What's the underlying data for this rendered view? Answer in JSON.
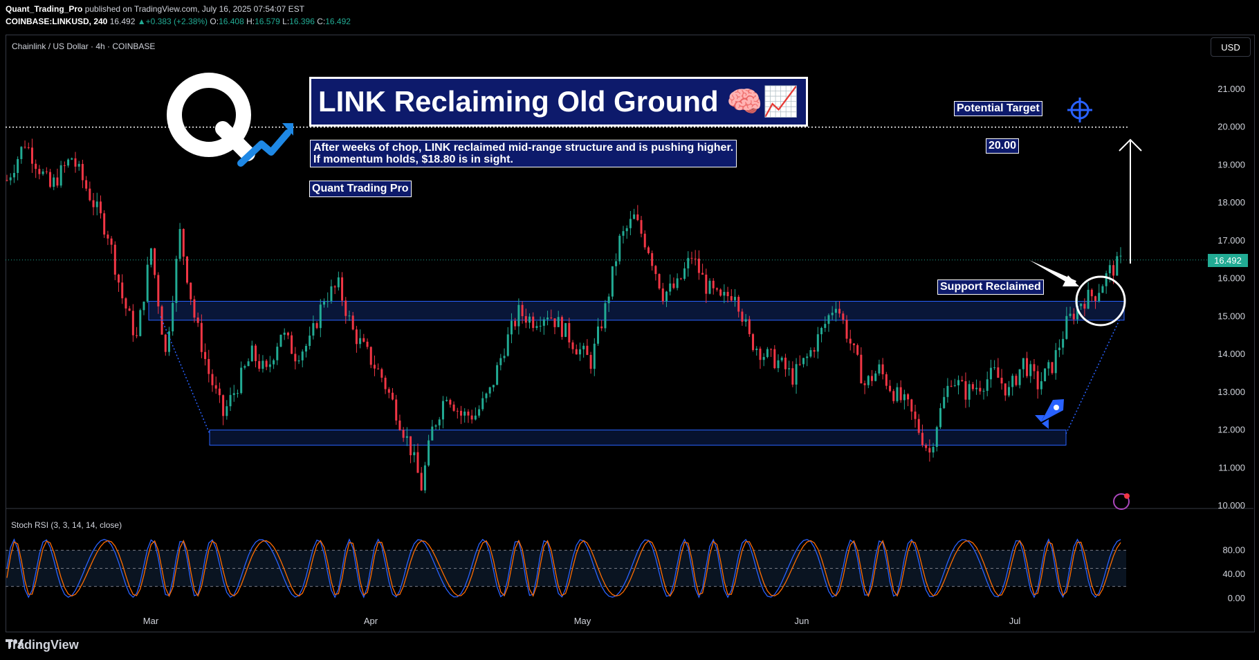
{
  "header": {
    "publisher": "Quant_Trading_Pro",
    "published_text": "published on TradingView.com, July 16, 2025 07:54:07 EST",
    "symbol": "COINBASE:LINKUSD, 240",
    "last": "16.492",
    "change_arrow": "▲",
    "change": "+0.383 (+2.38%)",
    "o_label": "O:",
    "o": "16.408",
    "h_label": "H:",
    "h": "16.579",
    "l_label": "L:",
    "l": "16.396",
    "c_label": "C:",
    "c": "16.492"
  },
  "pane_title": "Chainlink / US Dollar · 4h · COINBASE",
  "currency": "USD",
  "current_price_label": "16.492",
  "annotations": {
    "main_title": "LINK Reclaiming Old Ground 🧠📈",
    "subtitle_line1": "After weeks of chop, LINK reclaimed mid-range structure and is pushing higher.",
    "subtitle_line2": "If momentum holds, $18.80 is in sight.",
    "author": "Quant Trading Pro",
    "potential_target": "Potential Target",
    "target_value": "20.00",
    "support_reclaimed": "Support Reclaimed"
  },
  "indicator_label": "Stoch RSI (3, 3, 14, 14, close)",
  "footer_brand": "TradingView",
  "colors": {
    "up": "#22ab94",
    "down": "#f23645",
    "zone": "#2962ff",
    "stoch_k": "#2962ff",
    "stoch_d": "#ff6d00",
    "box_bg": "#0d1a6b"
  },
  "chart_data": {
    "type": "candlestick",
    "price_axis_ticks": [
      "21.000",
      "20.000",
      "19.000",
      "18.000",
      "17.000",
      "16.000",
      "15.000",
      "14.000",
      "13.000",
      "12.000",
      "11.000",
      "10.000"
    ],
    "ylim": [
      10.0,
      21.5
    ],
    "time_axis_ticks": [
      "Mar",
      "Apr",
      "May",
      "Jun",
      "Jul"
    ],
    "stoch_axis_ticks": [
      "80.00",
      "40.00",
      "0.00"
    ],
    "stoch_levels": [
      80,
      20
    ],
    "target_level": 20.0,
    "zones": [
      {
        "name": "resistance-turned-support",
        "y_low": 14.9,
        "y_high": 15.4
      },
      {
        "name": "range-low",
        "y_low": 11.6,
        "y_high": 12.0
      }
    ],
    "path": [
      [
        0,
        18.6
      ],
      [
        5,
        19.6
      ],
      [
        12,
        18.4
      ],
      [
        18,
        19.2
      ],
      [
        24,
        18.0
      ],
      [
        28,
        17.2
      ],
      [
        32,
        15.5
      ],
      [
        36,
        14.4
      ],
      [
        40,
        16.8
      ],
      [
        44,
        14.0
      ],
      [
        48,
        17.2
      ],
      [
        52,
        15.0
      ],
      [
        56,
        13.5
      ],
      [
        60,
        12.4
      ],
      [
        64,
        13.2
      ],
      [
        68,
        14.0
      ],
      [
        72,
        13.5
      ],
      [
        76,
        14.6
      ],
      [
        80,
        14.0
      ],
      [
        84,
        14.3
      ],
      [
        88,
        15.5
      ],
      [
        92,
        15.8
      ],
      [
        96,
        14.6
      ],
      [
        100,
        14.0
      ],
      [
        104,
        13.4
      ],
      [
        108,
        12.5
      ],
      [
        112,
        11.5
      ],
      [
        115,
        10.5
      ],
      [
        118,
        12.0
      ],
      [
        122,
        13.0
      ],
      [
        126,
        12.4
      ],
      [
        130,
        12.4
      ],
      [
        134,
        13.0
      ],
      [
        138,
        14.2
      ],
      [
        142,
        15.1
      ],
      [
        146,
        14.9
      ],
      [
        150,
        15.1
      ],
      [
        154,
        14.7
      ],
      [
        158,
        14.2
      ],
      [
        162,
        13.8
      ],
      [
        166,
        15.2
      ],
      [
        170,
        17.0
      ],
      [
        174,
        17.6
      ],
      [
        178,
        16.8
      ],
      [
        182,
        15.6
      ],
      [
        186,
        15.8
      ],
      [
        190,
        16.6
      ],
      [
        194,
        15.8
      ],
      [
        198,
        15.4
      ],
      [
        202,
        15.7
      ],
      [
        206,
        14.4
      ],
      [
        210,
        14.0
      ],
      [
        214,
        13.8
      ],
      [
        218,
        13.4
      ],
      [
        222,
        13.9
      ],
      [
        226,
        14.6
      ],
      [
        230,
        15.4
      ],
      [
        234,
        14.3
      ],
      [
        238,
        13.2
      ],
      [
        242,
        13.6
      ],
      [
        246,
        13.0
      ],
      [
        250,
        12.6
      ],
      [
        254,
        11.8
      ],
      [
        256,
        11.4
      ],
      [
        258,
        12.2
      ],
      [
        262,
        13.4
      ],
      [
        266,
        13.0
      ],
      [
        270,
        13.2
      ],
      [
        274,
        13.5
      ],
      [
        278,
        13.0
      ],
      [
        282,
        13.8
      ],
      [
        286,
        13.2
      ],
      [
        290,
        13.7
      ],
      [
        294,
        14.8
      ],
      [
        298,
        15.4
      ],
      [
        302,
        15.6
      ],
      [
        306,
        16.2
      ],
      [
        310,
        16.5
      ]
    ],
    "candle_count": 310
  }
}
